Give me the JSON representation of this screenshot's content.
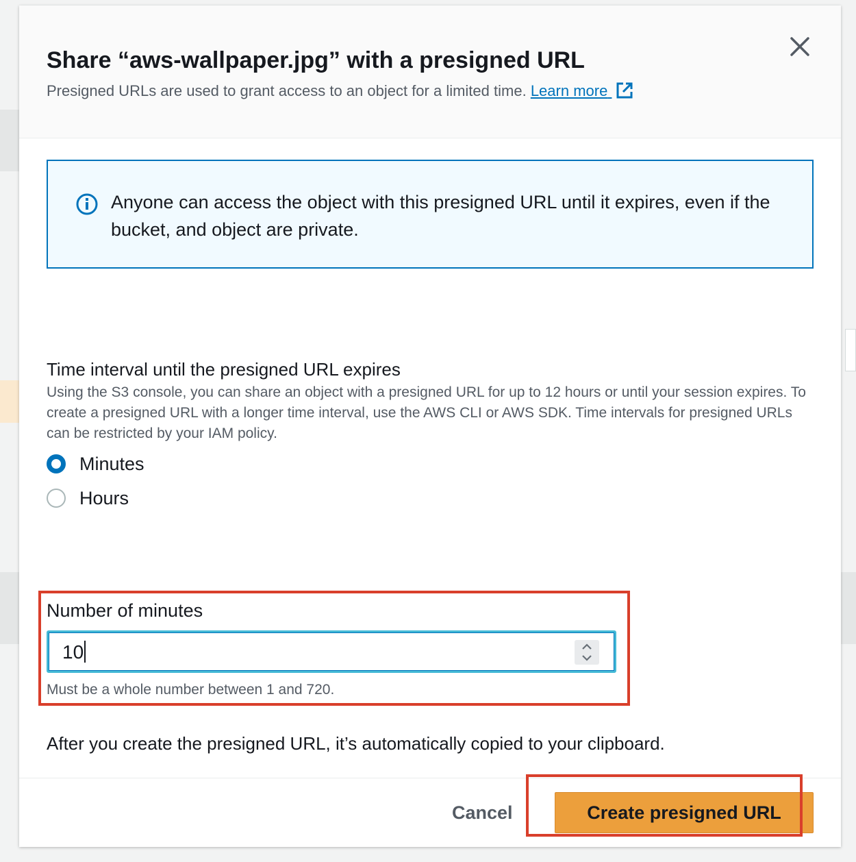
{
  "modal": {
    "title": "Share “aws-wallpaper.jpg” with a presigned URL",
    "subtitle": "Presigned URLs are used to grant access to an object for a limited time.",
    "learn_more": "Learn more"
  },
  "alert": {
    "text": "Anyone can access the object with this presigned URL until it expires, even if the bucket, and object are private."
  },
  "interval": {
    "label": "Time interval until the presigned URL expires",
    "description": "Using the S3 console, you can share an object with a presigned URL for up to 12 hours or until your session expires. To create a presigned URL with a longer time interval, use the AWS CLI or AWS SDK. Time intervals for presigned URLs can be restricted by your IAM policy.",
    "options": [
      {
        "label": "Minutes",
        "selected": true
      },
      {
        "label": "Hours",
        "selected": false
      }
    ]
  },
  "minutes": {
    "label": "Number of minutes",
    "value": "10",
    "hint": "Must be a whole number between 1 and 720."
  },
  "after_text": "After you create the presigned URL, it’s automatically copied to your clipboard.",
  "footer": {
    "cancel_label": "Cancel",
    "create_label": "Create presigned URL"
  },
  "colors": {
    "primary_button": "#ec9f3c",
    "link": "#0073bb",
    "highlight": "#d93f2b",
    "alert_background": "#f1faff"
  },
  "icons": [
    "close-icon",
    "external-link-icon",
    "info-icon",
    "spinner-up-icon",
    "spinner-down-icon"
  ]
}
